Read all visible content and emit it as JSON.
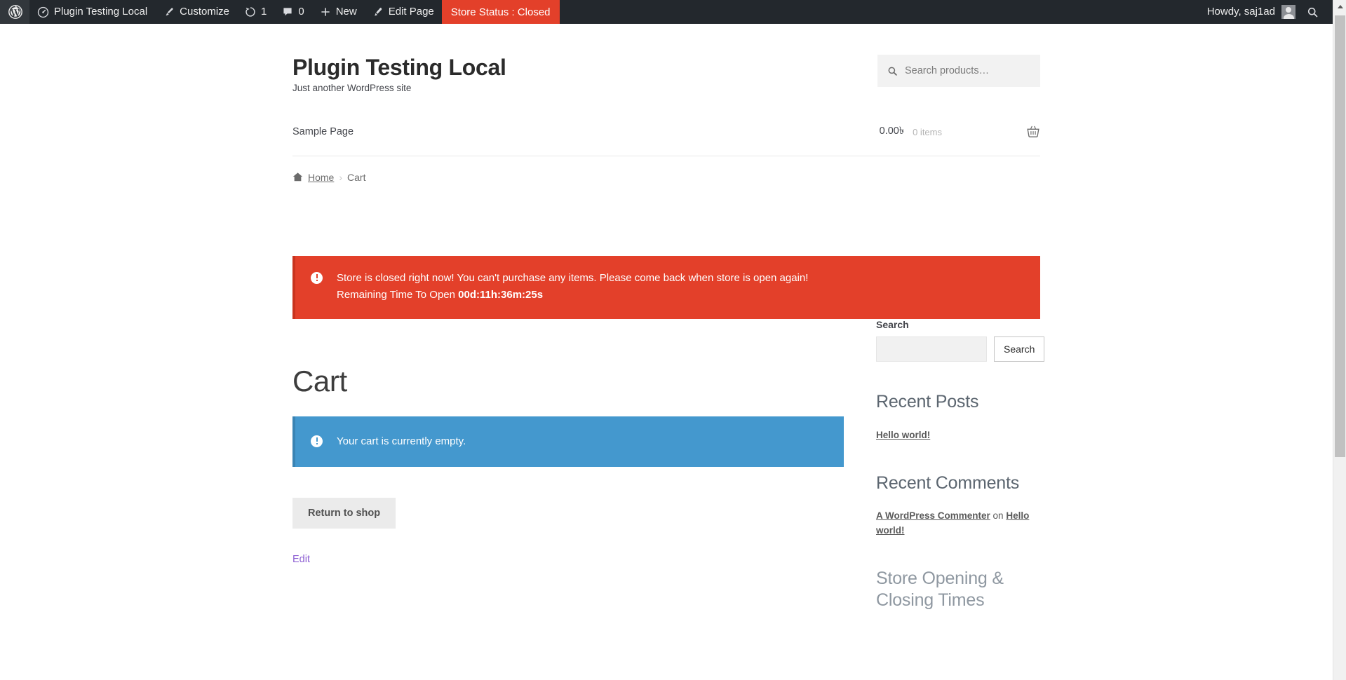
{
  "adminbar": {
    "logo_icon": "wordpress-logo-icon",
    "site_name": "Plugin Testing Local",
    "site_icon": "dashboard-icon",
    "customize": "Customize",
    "customize_icon": "paintbrush-icon",
    "updates_count": "1",
    "updates_icon": "updates-icon",
    "comments_count": "0",
    "comments_icon": "comment-bubble-icon",
    "new": "New",
    "new_icon": "plus-icon",
    "edit_page": "Edit Page",
    "edit_icon": "pencil-icon",
    "store_status": "Store Status : Closed",
    "store_status_color": "#e3402a",
    "howdy": "Howdy, saj1ad",
    "avatar_icon": "user-avatar",
    "search_icon": "search-icon"
  },
  "header": {
    "site_title": "Plugin Testing Local",
    "tagline": "Just another WordPress site",
    "product_search": {
      "placeholder": "Search products…",
      "value": "",
      "icon": "search-icon"
    }
  },
  "nav": {
    "items": [
      {
        "label": "Sample Page"
      }
    ],
    "cart": {
      "amount": "0.00৳",
      "items": "0 items",
      "icon": "shopping-basket-icon"
    }
  },
  "breadcrumb": {
    "home_icon": "home-icon",
    "home": "Home",
    "separator": "›",
    "current": "Cart"
  },
  "store_closed_alert": {
    "icon": "exclamation-circle-icon",
    "line1": "Store is closed right now! You can't purchase any items. Please come back when store is open again!",
    "line2_prefix": "Remaining Time To Open ",
    "countdown": "00d:11h:36m:25s",
    "bg_color": "#e3402a"
  },
  "page": {
    "title": "Cart"
  },
  "cart_empty_notice": {
    "icon": "exclamation-circle-icon",
    "text": "Your cart is currently empty.",
    "bg_color": "#4498ce"
  },
  "actions": {
    "return_to_shop": "Return to shop",
    "edit": "Edit",
    "edit_color": "#8d5fd3"
  },
  "sidebar": {
    "search_widget": {
      "label": "Search",
      "value": "",
      "placeholder": "",
      "button": "Search"
    },
    "recent_posts": {
      "title": "Recent Posts",
      "items": [
        {
          "label": "Hello world!"
        }
      ]
    },
    "recent_comments": {
      "title": "Recent Comments",
      "items": [
        {
          "author": "A WordPress Commenter",
          "on": " on ",
          "post": "Hello world!"
        }
      ]
    },
    "store_times": {
      "title": "Store Opening & Closing Times"
    }
  },
  "scrollbar": {
    "up_arrow_icon": "scroll-up-arrow-icon"
  }
}
